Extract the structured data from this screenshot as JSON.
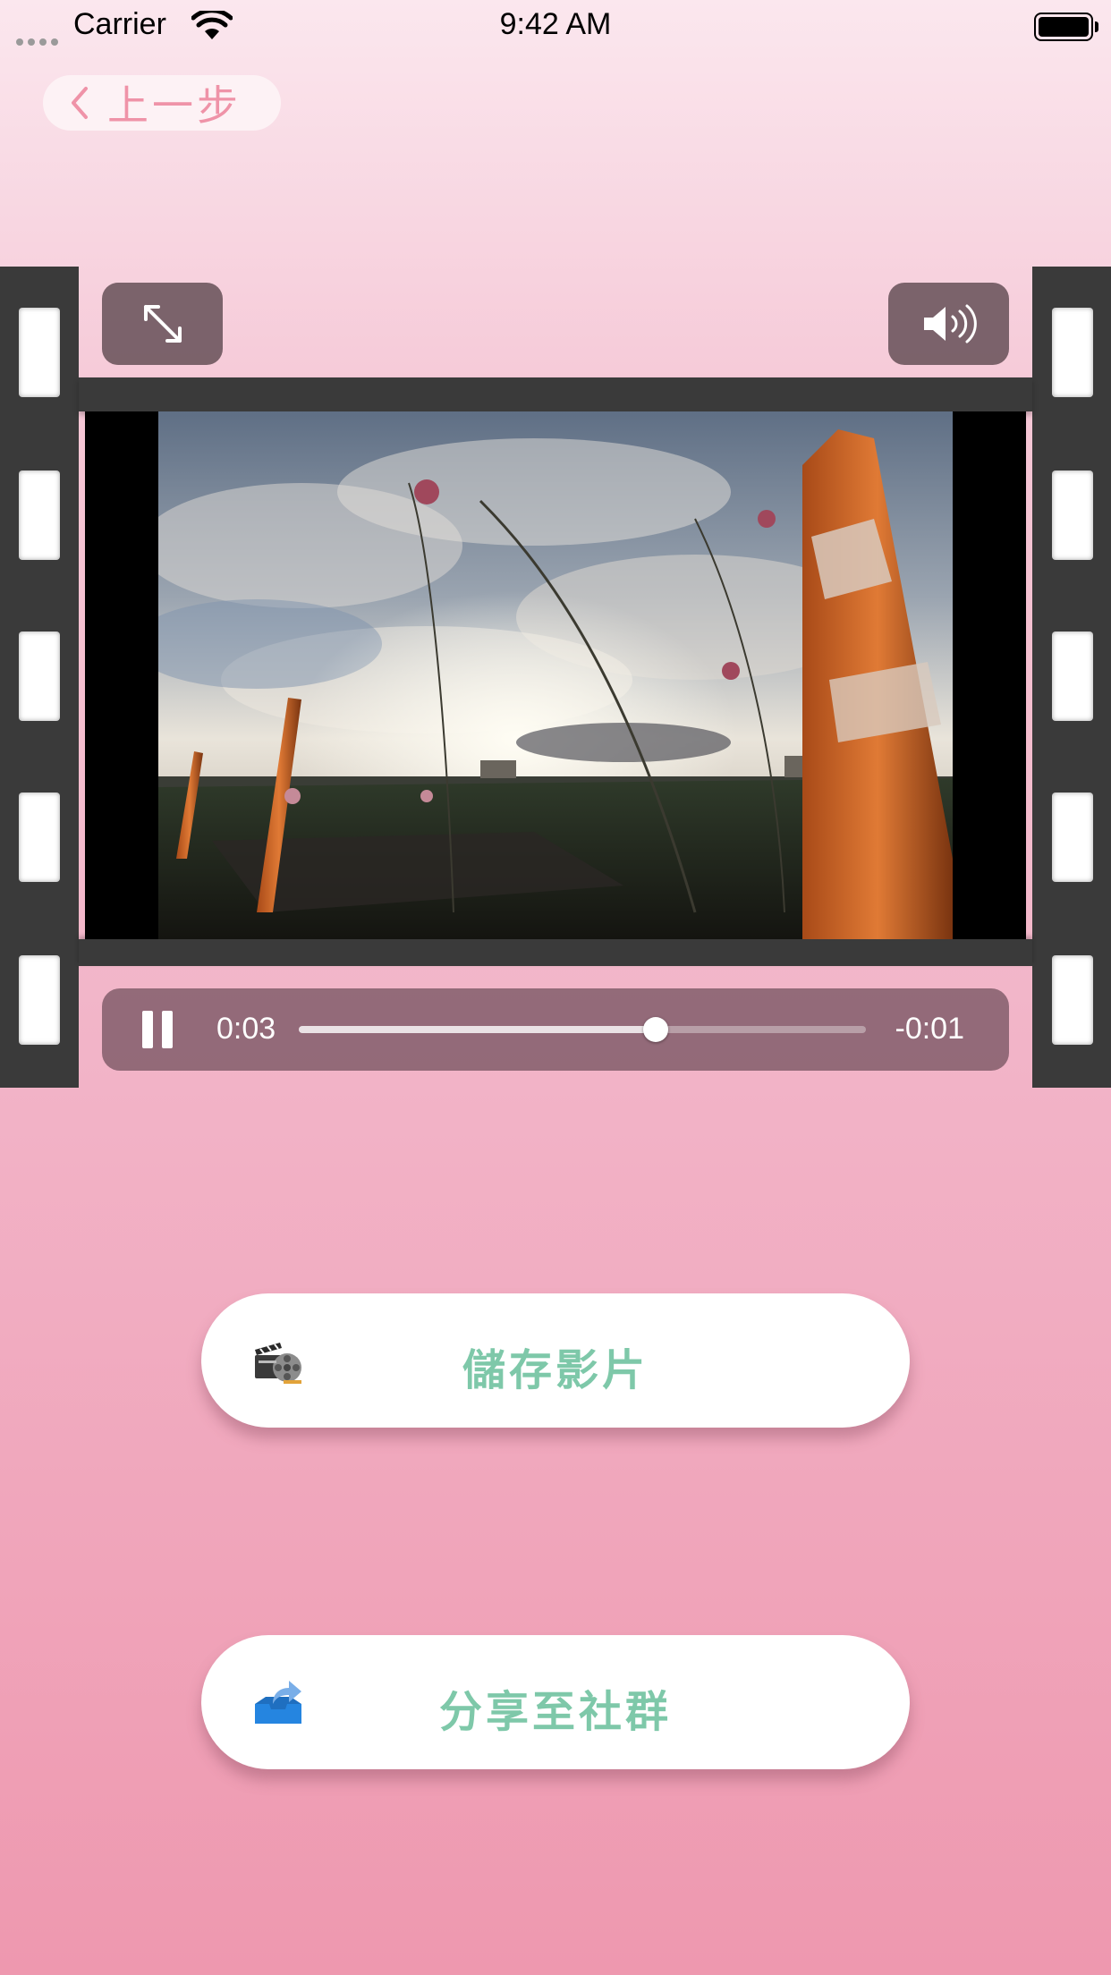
{
  "status_bar": {
    "carrier": "Carrier",
    "time": "9:42 AM"
  },
  "nav": {
    "back_label": "上一步"
  },
  "player": {
    "elapsed": "0:03",
    "remaining": "-0:01",
    "progress_fraction": 0.63,
    "state": "playing",
    "controls": {
      "fullscreen_icon": "expand-arrows-icon",
      "volume_icon": "speaker-volume-icon",
      "pause_icon": "pause-icon"
    }
  },
  "actions": {
    "save_label": "儲存影片",
    "save_icon": "film-clapper-reel-icon",
    "share_label": "分享至社群",
    "share_icon": "tray-share-arrow-icon"
  },
  "colors": {
    "accent_text": "#7ec8a9",
    "back_text": "#ef93a8",
    "background_top": "#fbe7ee",
    "background_bottom": "#ee98af"
  }
}
